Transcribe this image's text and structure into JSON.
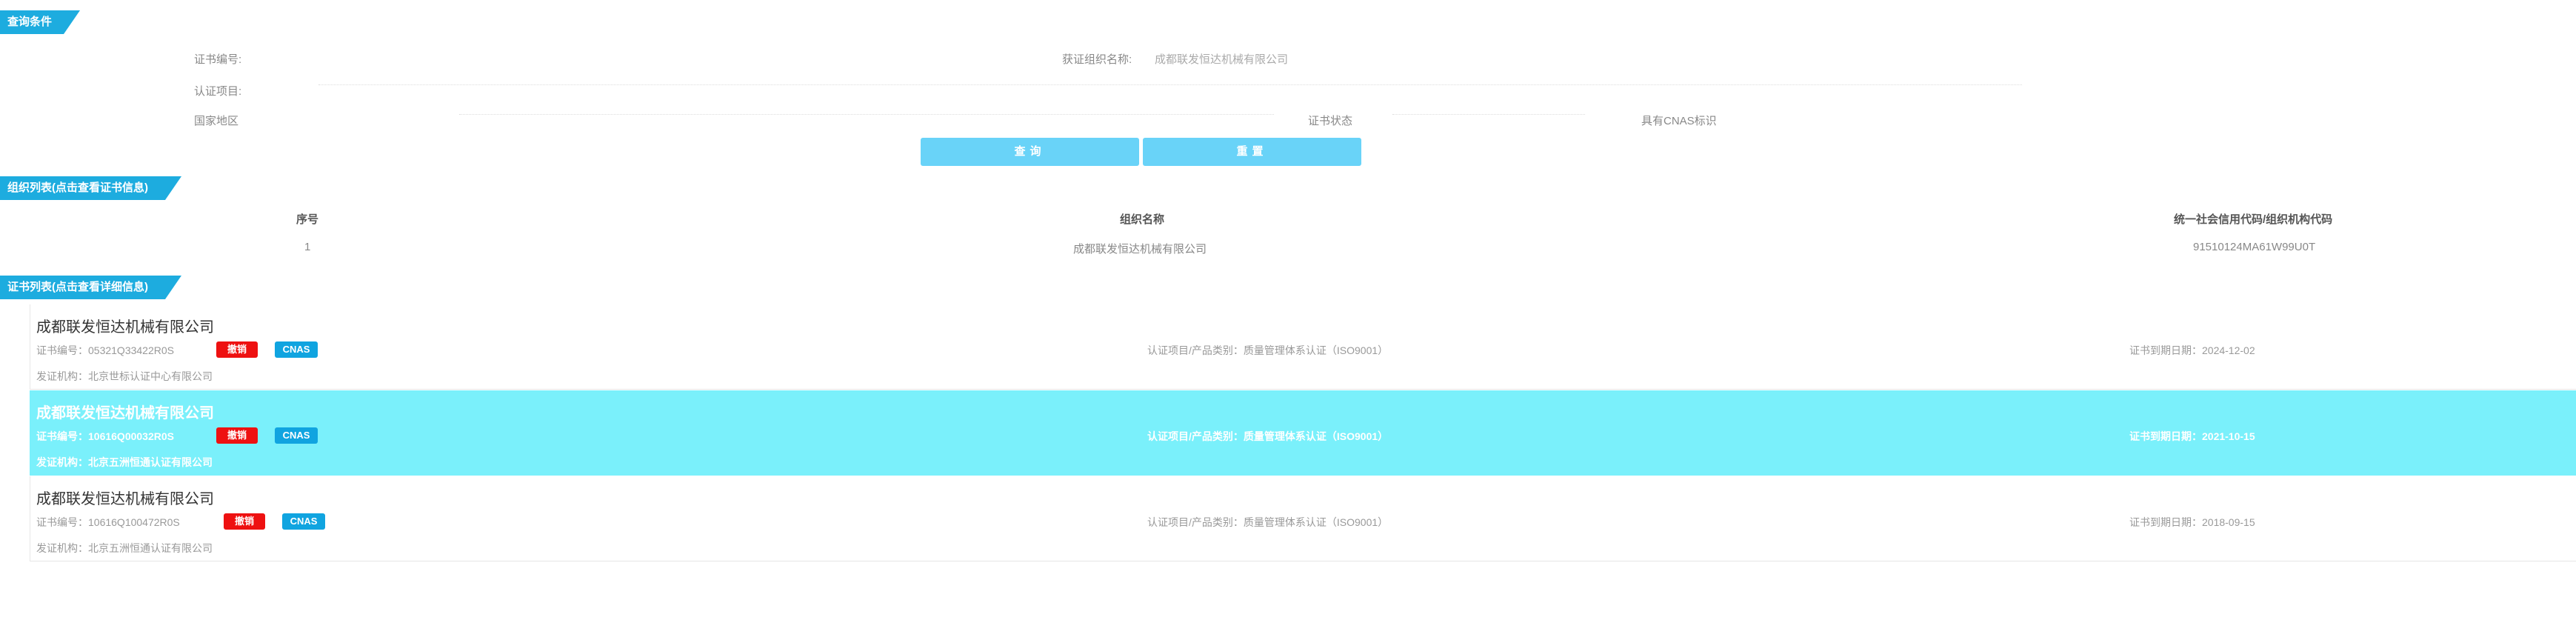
{
  "sections": {
    "query": "查询条件",
    "org_list": "组织列表(点击查看证书信息)",
    "cert_list": "证书列表(点击查看详细信息)"
  },
  "query": {
    "cert_no_label": "证书编号:",
    "org_name_label": "获证组织名称:",
    "org_name_value": "成都联发恒达机械有限公司",
    "cert_item_label": "认证项目:",
    "region_label": "国家地区",
    "status_label": "证书状态",
    "cnas_label": "具有CNAS标识",
    "search_label": "查询",
    "reset_label": "重置"
  },
  "org_table": {
    "headers": [
      "序号",
      "组织名称",
      "统一社会信用代码/组织机构代码"
    ],
    "rows": [
      {
        "index": "1",
        "name": "成都联发恒达机械有限公司",
        "code": "91510124MA61W99U0T"
      }
    ]
  },
  "certs": [
    {
      "company": "成都联发恒达机械有限公司",
      "cert_no": "证书编号：05321Q33422R0S",
      "status_tag": "撤销",
      "cnas_tag": "CNAS",
      "item": "认证项目/产品类别：质量管理体系认证（ISO9001）",
      "expiry": "证书到期日期：2024-12-02",
      "issuer": "发证机构：北京世标认证中心有限公司"
    },
    {
      "company": "成都联发恒达机械有限公司",
      "cert_no": "证书编号：10616Q00032R0S",
      "status_tag": "撤销",
      "cnas_tag": "CNAS",
      "item": "认证项目/产品类别：质量管理体系认证（ISO9001）",
      "expiry": "证书到期日期：2021-10-15",
      "issuer": "发证机构：北京五洲恒通认证有限公司"
    },
    {
      "company": "成都联发恒达机械有限公司",
      "cert_no": "证书编号：10616Q100472R0S",
      "status_tag": "撤销",
      "cnas_tag": "CNAS",
      "item": "认证项目/产品类别：质量管理体系认证（ISO9001）",
      "expiry": "证书到期日期：2018-09-15",
      "issuer": "发证机构：北京五洲恒通认证有限公司"
    }
  ],
  "colors": {
    "accent": "#1dacdf",
    "button": "#69d3f8",
    "selected_row": "#7af0fb",
    "revoked_tag": "#ee1111",
    "cnas_tag": "#10a4e0"
  }
}
